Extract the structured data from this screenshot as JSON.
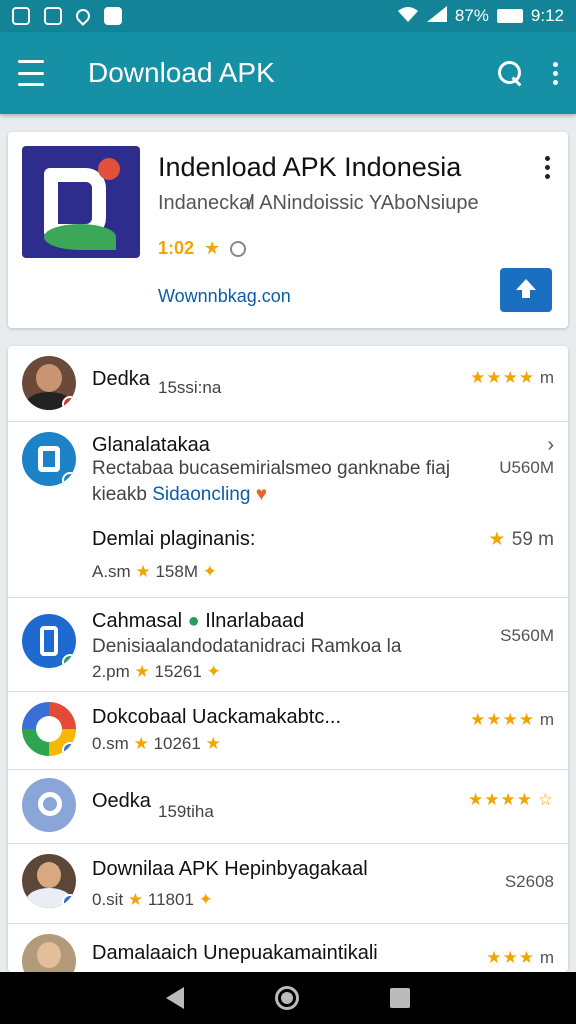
{
  "status": {
    "battery": "87%",
    "time": "9:12"
  },
  "appbar": {
    "title": "Download APK"
  },
  "featured": {
    "title": "Indenload APK Indonesia",
    "subtitle": "Indanecka̸l ANindoissic YAboNsiupe",
    "rating": "1:02",
    "rating_star": "★",
    "link": "Wownnbkag.con"
  },
  "list": [
    {
      "title": "Dedka",
      "meta": "15ssi:na",
      "right_stars": "★★★★",
      "right_text": "m"
    },
    {
      "title": "Glanalatakaa",
      "sub": "Rectabaa bucasemirialsmeo ganknabe fiaj",
      "sub2": "kieakb",
      "sub2_link": "Sidaoncling",
      "right_text": "U560M"
    },
    {
      "title": "Demlai plaginanis:",
      "meta_a": "A.sm",
      "meta_b": "158M",
      "right_stars": "★",
      "right_text": "59 m"
    },
    {
      "title": "Cahmasal",
      "title_b": "Ilnarlabaad",
      "sub": "Denisiaalandodatanidraci Ramkoa la",
      "meta_a": "2.pm",
      "meta_b": "15261",
      "right_text": "S560M"
    },
    {
      "title": "Dokcobaal Uackamakabtc...",
      "meta_a": "0.sm",
      "meta_b": "10261",
      "right_stars": "★★★★",
      "right_text": "m"
    },
    {
      "title": "Oedka",
      "meta": "159tiha",
      "right_stars": "★★★★"
    },
    {
      "title": "Downilaa APK Hepinbyagakaal",
      "meta_a": "0.sit",
      "meta_b": "11801",
      "right_text": "S2608"
    },
    {
      "title": "Damalaaich Unepuakamaintikali",
      "right_stars": "★★★",
      "right_text": "m"
    }
  ]
}
